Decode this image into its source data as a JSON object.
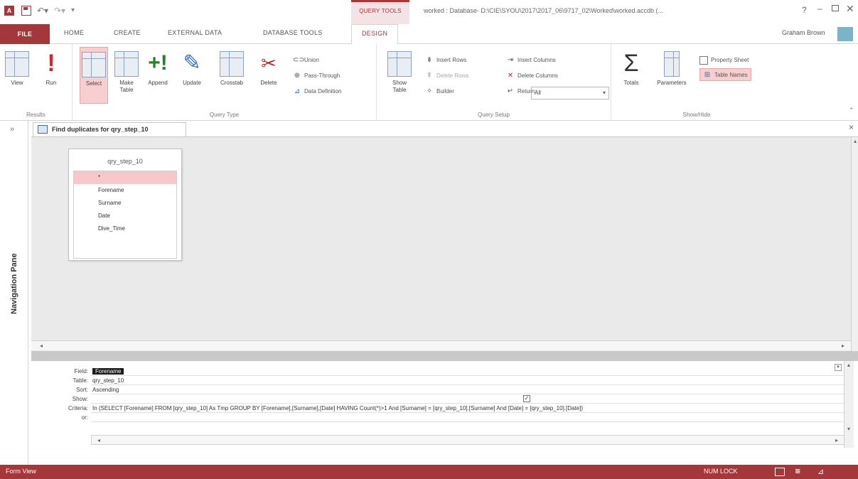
{
  "titlebar": {
    "app_icon": "A",
    "contextual_tab_group": "QUERY TOOLS",
    "window_title": "worked : Database- D:\\CIE\\SYOU\\2017\\2017_06\\9717_02\\Worked\\worked.accdb (..."
  },
  "tabs": {
    "file": "FILE",
    "home": "HOME",
    "create": "CREATE",
    "external_data": "EXTERNAL DATA",
    "database_tools": "DATABASE TOOLS",
    "design": "DESIGN"
  },
  "user": {
    "name": "Graham Brown"
  },
  "ribbon": {
    "results": {
      "label": "Results",
      "view": "View",
      "run": "Run"
    },
    "query_type": {
      "label": "Query Type",
      "select": "Select",
      "make_table_1": "Make",
      "make_table_2": "Table",
      "append": "Append",
      "update": "Update",
      "crosstab": "Crosstab",
      "delete": "Delete",
      "union": "Union",
      "pass_through": "Pass-Through",
      "data_definition": "Data Definition"
    },
    "query_setup": {
      "label": "Query Setup",
      "show_table_1": "Show",
      "show_table_2": "Table",
      "insert_rows": "Insert Rows",
      "delete_rows": "Delete Rows",
      "builder": "Builder",
      "insert_columns": "Insert Columns",
      "delete_columns": "Delete Columns",
      "return_label": "Return:",
      "return_value": "All"
    },
    "show_hide": {
      "label": "Show/Hide",
      "totals": "Totals",
      "parameters": "Parameters",
      "property_sheet": "Property Sheet",
      "table_names": "Table Names"
    }
  },
  "nav_pane": {
    "label": "Navigation Pane"
  },
  "document": {
    "tab_title": "Find duplicates for qry_step_10"
  },
  "field_list": {
    "title": "qry_step_10",
    "items": [
      "*",
      "Forename",
      "Surname",
      "Date",
      "Dive_Time"
    ]
  },
  "qbe": {
    "labels": {
      "field": "Field:",
      "table": "Table:",
      "sort": "Sort:",
      "show": "Show:",
      "criteria": "Criteria:",
      "or": "or:"
    },
    "field": "Forename",
    "table": "qry_step_10",
    "sort": "Ascending",
    "show_checked": "✓",
    "criteria": "In (SELECT [Forename] FROM [qry_step_10] As Tmp GROUP BY [Forename],[Surname],[Date] HAVING Count(*)>1  And [Surname] = [qry_step_10].[Surname] And [Date] = [qry_step_10].[Date])"
  },
  "status": {
    "left": "Form View",
    "numlock": "NUM LOCK"
  },
  "colors": {
    "accent": "#a4373a",
    "selected_bg": "#f7cfd1"
  }
}
